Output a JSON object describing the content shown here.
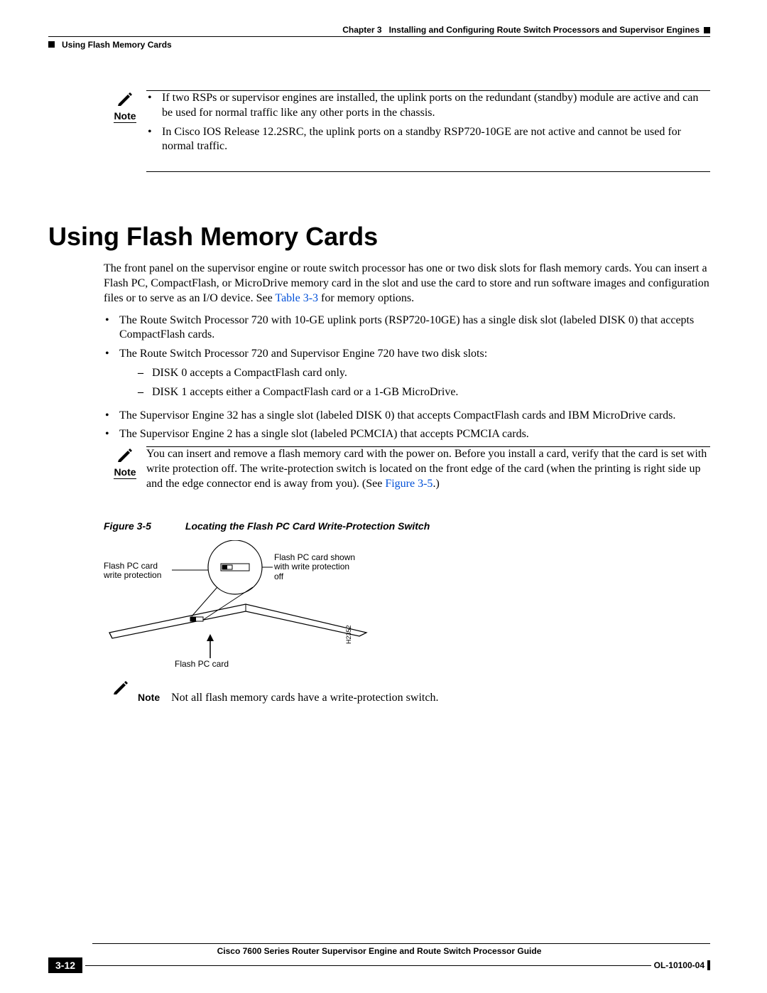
{
  "header": {
    "chapter_label": "Chapter 3",
    "chapter_title": "Installing and Configuring Route Switch Processors and Supervisor Engines",
    "section_title": "Using Flash Memory Cards"
  },
  "note1": {
    "label": "Note",
    "bullets": [
      "If two RSPs or supervisor engines are installed, the uplink ports on the redundant (standby) module are active and can be used for normal traffic like any other ports in the chassis.",
      "In Cisco IOS Release 12.2SRC, the uplink ports on a standby RSP720-10GE are not active and cannot be used for normal traffic."
    ]
  },
  "section_heading": "Using Flash Memory Cards",
  "intro_para_1": "The front panel on the supervisor engine or route switch processor has one or two disk slots for flash memory cards. You can insert a Flash PC, CompactFlash, or MicroDrive memory card in the slot and use the card to store and run software images and configuration files or to serve as an I/O device. See ",
  "intro_link_1": "Table 3-3",
  "intro_para_1_tail": " for memory options.",
  "main_bullets": {
    "b1": "The Route Switch Processor 720 with 10-GE uplink ports (RSP720-10GE) has a single disk slot (labeled DISK 0) that accepts CompactFlash cards.",
    "b2": "The Route Switch Processor 720 and Supervisor Engine 720 have two disk slots:",
    "b2_sub1": "DISK 0 accepts a CompactFlash card only.",
    "b2_sub2": "DISK 1 accepts either a CompactFlash card or a 1-GB MicroDrive.",
    "b3": "The Supervisor Engine 32 has a single slot (labeled DISK 0) that accepts CompactFlash cards and IBM MicroDrive cards.",
    "b4": "The Supervisor Engine 2 has a single slot (labeled PCMCIA) that accepts PCMCIA cards."
  },
  "note2": {
    "label": "Note",
    "text_pre": "You can insert and remove a flash memory card with the power on. Before you install a card, verify that the card is set with write protection off. The write-protection switch is located on the front edge of the card (when the printing is right side up and the edge connector end is away from you). (See ",
    "link": "Figure 3-5",
    "text_post": ".)"
  },
  "figure": {
    "number": "Figure 3-5",
    "title": "Locating the Flash PC Card Write-Protection Switch",
    "label_left": "Flash PC card write protection",
    "label_right": "Flash PC card shown with write protection off",
    "label_bottom": "Flash PC card",
    "hcode": "H2352"
  },
  "note3": {
    "label": "Note",
    "text": "Not all flash memory cards have a write-protection switch."
  },
  "footer": {
    "guide_title": "Cisco 7600 Series Router Supervisor Engine and Route Switch Processor Guide",
    "page_number": "3-12",
    "doc_number": "OL-10100-04"
  }
}
